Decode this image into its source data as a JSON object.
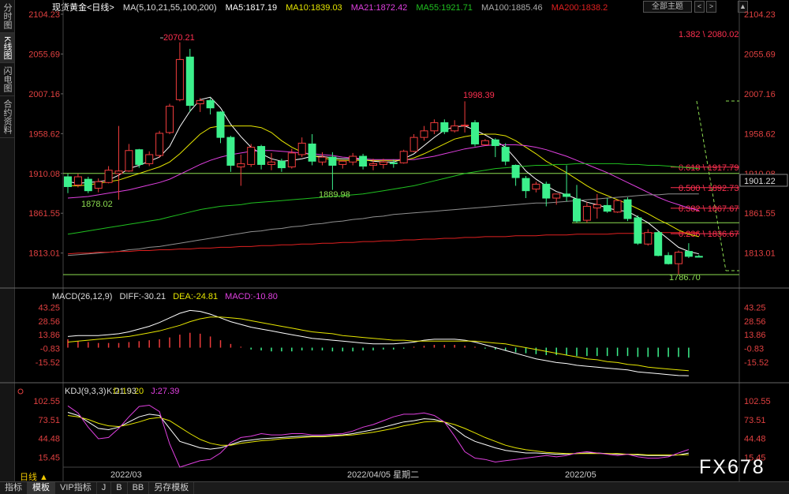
{
  "left_tabs": [
    "分时图",
    "K线图",
    "闪电图",
    "合约资料"
  ],
  "header": {
    "symbol": "现货黄金<日线>",
    "ma_label": "MA(5,10,21,55,100,200)",
    "ma5": "MA5:1817.19",
    "ma10": "MA10:1839.03",
    "ma21": "MA21:1872.42",
    "ma55": "MA55:1921.71",
    "ma100": "MA100:1885.46",
    "ma200": "MA200:1838.2",
    "theme_button": "全部主题",
    "nav_prev": "<",
    "nav_next": ">",
    "corner": "▲"
  },
  "colors": {
    "up": "#f03c3c",
    "down": "#3cf08c",
    "ma5": "#ffffff",
    "ma10": "#e6e600",
    "ma21": "#e040e0",
    "ma55": "#20c020",
    "ma100": "#909090",
    "ma200": "#e02020",
    "fib": "#ff3050",
    "hline": "#8cdc50"
  },
  "price_axis": [
    "2104.23",
    "2055.69",
    "2007.16",
    "1958.62",
    "1910.08",
    "1861.55",
    "1813.01"
  ],
  "current_price": "1901.22",
  "annotations": {
    "high": "2070.21",
    "mid_high": "1998.39",
    "low1": "1878.02",
    "low2": "1889.98",
    "last_low": "1786.70"
  },
  "fib_levels": [
    "1.382 \\ 2080.02",
    "0.618 \\ 1917.79",
    "0.500 \\ 1892.73",
    "0.382 \\ 1867.67",
    "0.236 \\ 1836.67"
  ],
  "date_labels": [
    "2022/03",
    "2022/04/05 星期二",
    "2022/05"
  ],
  "macd": {
    "header": "MACD(26,12,9)",
    "diff": "DIFF:-30.21",
    "dea": "DEA:-24.81",
    "macd": "MACD:-10.80",
    "axis": [
      "43.25",
      "28.56",
      "13.86",
      "-0.83",
      "-15.52"
    ]
  },
  "kdj": {
    "header": "KDJ(9,3,3)",
    "k": "K:21.93",
    "d": "D:19.20",
    "j": "J:27.39",
    "axis": [
      "102.55",
      "73.51",
      "44.48",
      "15.45"
    ]
  },
  "bottom_tabs": [
    "指标",
    "模板",
    "VIP指标",
    "J",
    "B",
    "BB",
    "另存模板"
  ],
  "period_button": "日线 ▲",
  "watermark": "FX678",
  "chart_data": {
    "type": "candlestick",
    "title": "现货黄金<日线>",
    "ylim": [
      1786.7,
      2104.23
    ],
    "candles": [
      {
        "o": 1906,
        "h": 1910,
        "c": 1894,
        "l": 1886
      },
      {
        "o": 1896,
        "h": 1910,
        "c": 1906,
        "l": 1893
      },
      {
        "o": 1903,
        "h": 1906,
        "c": 1889,
        "l": 1886
      },
      {
        "o": 1892,
        "h": 1904,
        "c": 1900,
        "l": 1887
      },
      {
        "o": 1899,
        "h": 1919,
        "c": 1914,
        "l": 1898
      },
      {
        "o": 1910,
        "h": 1968,
        "c": 1913,
        "l": 1878
      },
      {
        "o": 1913,
        "h": 1946,
        "c": 1938,
        "l": 1912
      },
      {
        "o": 1939,
        "h": 1940,
        "c": 1921,
        "l": 1917
      },
      {
        "o": 1922,
        "h": 1937,
        "c": 1933,
        "l": 1919
      },
      {
        "o": 1932,
        "h": 1962,
        "c": 1959,
        "l": 1929
      },
      {
        "o": 1960,
        "h": 1995,
        "c": 1992,
        "l": 1958
      },
      {
        "o": 2000,
        "h": 2070,
        "c": 2049,
        "l": 1998
      },
      {
        "o": 2052,
        "h": 2062,
        "c": 1993,
        "l": 1985
      },
      {
        "o": 1995,
        "h": 2002,
        "c": 1999,
        "l": 1985
      },
      {
        "o": 1999,
        "h": 2002,
        "c": 1990,
        "l": 1982
      },
      {
        "o": 1985,
        "h": 1986,
        "c": 1954,
        "l": 1947
      },
      {
        "o": 1954,
        "h": 1956,
        "c": 1920,
        "l": 1912
      },
      {
        "o": 1918,
        "h": 1933,
        "c": 1922,
        "l": 1895
      },
      {
        "o": 1921,
        "h": 1946,
        "c": 1942,
        "l": 1918
      },
      {
        "o": 1943,
        "h": 1945,
        "c": 1921,
        "l": 1915
      },
      {
        "o": 1921,
        "h": 1935,
        "c": 1924,
        "l": 1914
      },
      {
        "o": 1925,
        "h": 1928,
        "c": 1917,
        "l": 1912
      },
      {
        "o": 1918,
        "h": 1940,
        "c": 1935,
        "l": 1916
      },
      {
        "o": 1933,
        "h": 1954,
        "c": 1947,
        "l": 1930
      },
      {
        "o": 1946,
        "h": 1958,
        "c": 1925,
        "l": 1920
      },
      {
        "o": 1924,
        "h": 1936,
        "c": 1930,
        "l": 1920
      },
      {
        "o": 1930,
        "h": 1936,
        "c": 1920,
        "l": 1890
      },
      {
        "o": 1921,
        "h": 1926,
        "c": 1925,
        "l": 1916
      },
      {
        "o": 1924,
        "h": 1935,
        "c": 1931,
        "l": 1920
      },
      {
        "o": 1931,
        "h": 1934,
        "c": 1919,
        "l": 1915
      },
      {
        "o": 1920,
        "h": 1928,
        "c": 1922,
        "l": 1914
      },
      {
        "o": 1921,
        "h": 1928,
        "c": 1924,
        "l": 1916
      },
      {
        "o": 1923,
        "h": 1927,
        "c": 1922,
        "l": 1917
      },
      {
        "o": 1923,
        "h": 1939,
        "c": 1937,
        "l": 1922
      },
      {
        "o": 1937,
        "h": 1958,
        "c": 1954,
        "l": 1936
      },
      {
        "o": 1954,
        "h": 1968,
        "c": 1962,
        "l": 1950
      },
      {
        "o": 1962,
        "h": 1976,
        "c": 1972,
        "l": 1958
      },
      {
        "o": 1972,
        "h": 1976,
        "c": 1961,
        "l": 1958
      },
      {
        "o": 1962,
        "h": 1975,
        "c": 1968,
        "l": 1960
      },
      {
        "o": 1968,
        "h": 1998,
        "c": 1969,
        "l": 1960
      },
      {
        "o": 1972,
        "h": 1975,
        "c": 1946,
        "l": 1943
      },
      {
        "o": 1945,
        "h": 1952,
        "c": 1950,
        "l": 1944
      },
      {
        "o": 1951,
        "h": 1953,
        "c": 1944,
        "l": 1930
      },
      {
        "o": 1942,
        "h": 1947,
        "c": 1925,
        "l": 1920
      },
      {
        "o": 1920,
        "h": 1921,
        "c": 1905,
        "l": 1895
      },
      {
        "o": 1904,
        "h": 1907,
        "c": 1889,
        "l": 1880
      },
      {
        "o": 1891,
        "h": 1900,
        "c": 1897,
        "l": 1887
      },
      {
        "o": 1897,
        "h": 1900,
        "c": 1880,
        "l": 1870
      },
      {
        "o": 1880,
        "h": 1884,
        "c": 1885,
        "l": 1872
      },
      {
        "o": 1885,
        "h": 1920,
        "c": 1882,
        "l": 1876
      },
      {
        "o": 1879,
        "h": 1896,
        "c": 1852,
        "l": 1850
      },
      {
        "o": 1853,
        "h": 1875,
        "c": 1870,
        "l": 1850
      },
      {
        "o": 1868,
        "h": 1885,
        "c": 1872,
        "l": 1855
      },
      {
        "o": 1871,
        "h": 1880,
        "c": 1864,
        "l": 1862
      },
      {
        "o": 1863,
        "h": 1877,
        "c": 1877,
        "l": 1862
      },
      {
        "o": 1878,
        "h": 1881,
        "c": 1855,
        "l": 1852
      },
      {
        "o": 1856,
        "h": 1859,
        "c": 1825,
        "l": 1823
      },
      {
        "o": 1824,
        "h": 1842,
        "c": 1838,
        "l": 1822
      },
      {
        "o": 1838,
        "h": 1840,
        "c": 1810,
        "l": 1809
      },
      {
        "o": 1810,
        "h": 1814,
        "c": 1800,
        "l": 1799
      },
      {
        "o": 1800,
        "h": 1816,
        "c": 1814,
        "l": 1786.7
      },
      {
        "o": 1815,
        "h": 1825,
        "c": 1809,
        "l": 1807
      },
      {
        "o": 1809,
        "h": 1811,
        "c": 1808,
        "l": 1808
      }
    ],
    "moving_averages": {
      "MA5": [
        1900,
        1898,
        1899,
        1900,
        1902,
        1908,
        1916,
        1920,
        1925,
        1930,
        1943,
        1967,
        1986,
        2000,
        2003,
        1990,
        1970,
        1955,
        1942,
        1934,
        1928,
        1925,
        1926,
        1928,
        1931,
        1931,
        1929,
        1928,
        1928,
        1927,
        1925,
        1924,
        1924,
        1928,
        1934,
        1944,
        1954,
        1963,
        1967,
        1968,
        1963,
        1957,
        1950,
        1942,
        1928,
        1913,
        1903,
        1895,
        1888,
        1884,
        1879,
        1875,
        1872,
        1868,
        1865,
        1864,
        1857,
        1850,
        1840,
        1830,
        1820,
        1815,
        1812
      ],
      "MA10": [
        1895,
        1895,
        1896,
        1898,
        1900,
        1902,
        1906,
        1910,
        1914,
        1918,
        1924,
        1934,
        1946,
        1958,
        1966,
        1968,
        1968,
        1968,
        1968,
        1966,
        1960,
        1950,
        1942,
        1936,
        1932,
        1929,
        1927,
        1926,
        1926,
        1926,
        1926,
        1926,
        1926,
        1926,
        1929,
        1934,
        1940,
        1946,
        1952,
        1955,
        1957,
        1958,
        1958,
        1956,
        1950,
        1942,
        1934,
        1925,
        1918,
        1911,
        1903,
        1895,
        1888,
        1883,
        1878,
        1873,
        1867,
        1861,
        1854,
        1848,
        1841,
        1836,
        1833
      ],
      "MA21": [
        1880,
        1881,
        1882,
        1884,
        1886,
        1888,
        1890,
        1893,
        1896,
        1899,
        1903,
        1909,
        1915,
        1921,
        1926,
        1930,
        1933,
        1935,
        1937,
        1938,
        1938,
        1937,
        1936,
        1935,
        1934,
        1933,
        1932,
        1930,
        1929,
        1928,
        1927,
        1927,
        1927,
        1927,
        1927,
        1929,
        1931,
        1934,
        1937,
        1940,
        1942,
        1944,
        1945,
        1945,
        1945,
        1944,
        1942,
        1939,
        1935,
        1931,
        1926,
        1921,
        1916,
        1911,
        1905,
        1899,
        1893,
        1887,
        1881,
        1876,
        1872,
        1868,
        1865
      ],
      "MA55": [
        1836,
        1838,
        1840,
        1842,
        1844,
        1846,
        1848,
        1850,
        1852,
        1854,
        1857,
        1860,
        1863,
        1866,
        1868,
        1870,
        1871,
        1872,
        1874,
        1875,
        1876,
        1877,
        1878,
        1879,
        1880,
        1881,
        1882,
        1883,
        1884,
        1885,
        1887,
        1889,
        1891,
        1893,
        1895,
        1898,
        1901,
        1904,
        1907,
        1910,
        1912,
        1914,
        1916,
        1917,
        1918,
        1919,
        1920,
        1920,
        1921,
        1921,
        1922,
        1922,
        1922,
        1922,
        1922,
        1921,
        1921,
        1920,
        1920,
        1919,
        1918,
        1917,
        1916
      ],
      "MA100": [
        1810,
        1811,
        1812,
        1813,
        1814,
        1815,
        1817,
        1818,
        1820,
        1821,
        1823,
        1825,
        1827,
        1829,
        1831,
        1833,
        1835,
        1837,
        1839,
        1840,
        1842,
        1843,
        1845,
        1846,
        1848,
        1849,
        1851,
        1852,
        1854,
        1855,
        1857,
        1858,
        1860,
        1861,
        1862,
        1863,
        1864,
        1865,
        1866,
        1867,
        1868,
        1869,
        1870,
        1871,
        1872,
        1873,
        1874,
        1874,
        1875,
        1876,
        1877,
        1878,
        1879,
        1880,
        1881,
        1882,
        1883,
        1884,
        1884,
        1885,
        1885,
        1885,
        1885
      ],
      "MA200": [
        1812,
        1813,
        1813,
        1814,
        1814,
        1815,
        1815,
        1816,
        1816,
        1817,
        1817,
        1818,
        1818,
        1819,
        1819,
        1820,
        1820,
        1821,
        1821,
        1822,
        1822,
        1823,
        1823,
        1824,
        1824,
        1825,
        1825,
        1826,
        1826,
        1827,
        1827,
        1828,
        1828,
        1829,
        1829,
        1830,
        1830,
        1831,
        1831,
        1832,
        1832,
        1833,
        1833,
        1833,
        1834,
        1834,
        1834,
        1835,
        1835,
        1835,
        1836,
        1836,
        1836,
        1836,
        1837,
        1837,
        1837,
        1837,
        1838,
        1838,
        1838,
        1838,
        1838
      ]
    },
    "fibonacci": [
      2080.02,
      1917.79,
      1892.73,
      1867.67,
      1836.67
    ],
    "macd_ylim": [
      -25,
      48
    ],
    "macd_hist": [
      9,
      7,
      6,
      5,
      5,
      5,
      6,
      7,
      8,
      9,
      11,
      14,
      16,
      15,
      12,
      8,
      4,
      1,
      -2,
      -3,
      -4,
      -4,
      -4,
      -3,
      -3,
      -3,
      -4,
      -4,
      -4,
      -3,
      -3,
      -2,
      -2,
      -1,
      1,
      2,
      3,
      3,
      3,
      2,
      1,
      -1,
      -2,
      -3,
      -5,
      -6,
      -7,
      -8,
      -8,
      -8,
      -9,
      -9,
      -9,
      -9,
      -9,
      -9,
      -10,
      -10,
      -10,
      -10,
      -10,
      -10.8
    ],
    "macd_diff": [
      12,
      13,
      13,
      13,
      14,
      15,
      17,
      20,
      23,
      27,
      32,
      37,
      40,
      39,
      36,
      32,
      28,
      25,
      22,
      20,
      18,
      16,
      14,
      12,
      10,
      9,
      8,
      7,
      6,
      5,
      4,
      4,
      4,
      5,
      6,
      8,
      9,
      9,
      9,
      8,
      6,
      3,
      0,
      -3,
      -6,
      -9,
      -12,
      -14,
      -16,
      -17,
      -19,
      -20,
      -21,
      -22,
      -23,
      -24,
      -26,
      -27,
      -28,
      -29,
      -30,
      -30.21
    ],
    "macd_dea": [
      6,
      7,
      8,
      9,
      10,
      11,
      12,
      14,
      16,
      18,
      21,
      24,
      28,
      31,
      33,
      33,
      32,
      31,
      29,
      27,
      25,
      23,
      21,
      19,
      17,
      16,
      15,
      13,
      12,
      11,
      10,
      9,
      8,
      8,
      7,
      7,
      7,
      7,
      7,
      7,
      7,
      6,
      5,
      4,
      2,
      0,
      -2,
      -4,
      -6,
      -8,
      -10,
      -12,
      -13,
      -15,
      -16,
      -18,
      -19,
      -21,
      -22,
      -23,
      -24,
      -24.81
    ],
    "kdj_ylim": [
      0,
      110
    ],
    "kdj_k": [
      85,
      80,
      70,
      60,
      58,
      62,
      70,
      78,
      82,
      80,
      60,
      40,
      35,
      30,
      28,
      30,
      35,
      40,
      42,
      44,
      45,
      46,
      47,
      48,
      48,
      48,
      49,
      50,
      52,
      55,
      58,
      62,
      66,
      70,
      72,
      75,
      74,
      70,
      60,
      48,
      40,
      35,
      30,
      26,
      24,
      22,
      22,
      21,
      20,
      20,
      21,
      22,
      22,
      21,
      20,
      20,
      19,
      18,
      18,
      18,
      19,
      21.93
    ],
    "kdj_d": [
      80,
      78,
      74,
      68,
      64,
      63,
      66,
      70,
      75,
      77,
      72,
      62,
      52,
      43,
      37,
      34,
      34,
      37,
      39,
      41,
      42,
      44,
      45,
      46,
      47,
      47,
      48,
      49,
      50,
      52,
      54,
      57,
      60,
      64,
      67,
      70,
      71,
      70,
      66,
      60,
      53,
      46,
      40,
      34,
      30,
      27,
      25,
      23,
      22,
      21,
      21,
      21,
      21,
      21,
      21,
      20,
      20,
      19,
      19,
      19,
      19,
      19.2
    ],
    "kdj_j": [
      95,
      84,
      62,
      44,
      46,
      60,
      78,
      94,
      96,
      86,
      36,
      0,
      5,
      10,
      12,
      22,
      38,
      46,
      48,
      52,
      50,
      50,
      52,
      52,
      50,
      50,
      51,
      52,
      56,
      62,
      66,
      72,
      78,
      82,
      82,
      84,
      80,
      70,
      48,
      24,
      14,
      12,
      8,
      10,
      12,
      14,
      16,
      18,
      16,
      18,
      22,
      24,
      22,
      20,
      18,
      20,
      16,
      14,
      14,
      16,
      22,
      27.39
    ]
  }
}
